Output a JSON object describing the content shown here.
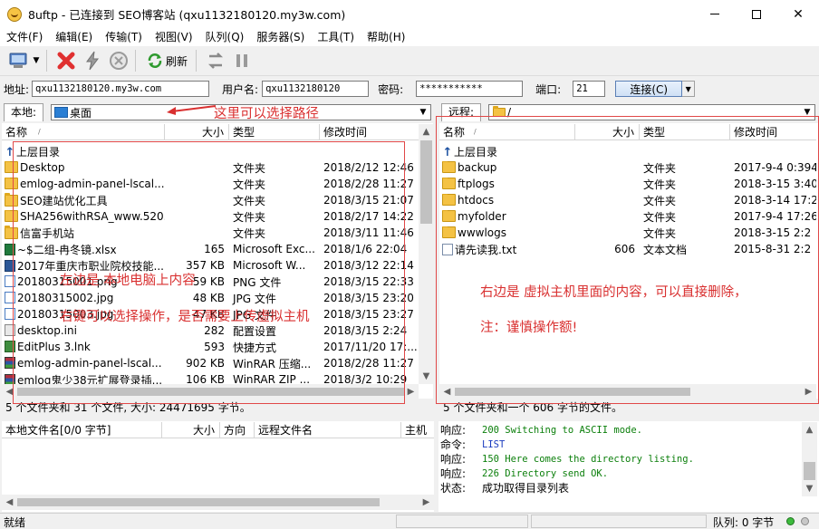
{
  "window": {
    "title": "8uftp - 已连接到 SEO博客站 (qxu1132180120.my3w.com)",
    "minimize": "—",
    "maximize": "☐",
    "close": "✕"
  },
  "menu": [
    "文件(F)",
    "编辑(E)",
    "传输(T)",
    "视图(V)",
    "队列(Q)",
    "服务器(S)",
    "工具(T)",
    "帮助(H)"
  ],
  "toolbar": {
    "refresh_label": "刷新"
  },
  "connection": {
    "address_label": "地址:",
    "address_value": "qxu1132180120.my3w.com",
    "user_label": "用户名:",
    "user_value": "qxu1132180120",
    "password_label": "密码:",
    "password_value": "***********",
    "port_label": "端口:",
    "port_value": "21",
    "connect_label": "连接(C)"
  },
  "local": {
    "tab_label": "本地:",
    "path": "桌面",
    "columns": {
      "name": "名称",
      "size": "大小",
      "type": "类型",
      "modified": "修改时间"
    },
    "parent_dir": "上层目录",
    "files": [
      {
        "icon": "folder",
        "name": "Desktop",
        "size": "",
        "type": "文件夹",
        "modified": "2018/2/12 12:46"
      },
      {
        "icon": "folder",
        "name": "emlog-admin-panel-lscal...",
        "size": "",
        "type": "文件夹",
        "modified": "2018/2/28 11:27"
      },
      {
        "icon": "folder",
        "name": "SEO建站优化工具",
        "size": "",
        "type": "文件夹",
        "modified": "2018/3/15 21:07"
      },
      {
        "icon": "folder",
        "name": "SHA256withRSA_www.520...",
        "size": "",
        "type": "文件夹",
        "modified": "2018/2/17 14:22"
      },
      {
        "icon": "folder",
        "name": "信富手机站",
        "size": "",
        "type": "文件夹",
        "modified": "2018/3/11 11:46"
      },
      {
        "icon": "xls",
        "name": "~$二组-冉冬镜.xlsx",
        "size": "165",
        "type": "Microsoft Exc...",
        "modified": "2018/1/6 22:04"
      },
      {
        "icon": "docx",
        "name": "2017年重庆市职业院校技能...",
        "size": "357 KB",
        "type": "Microsoft W...",
        "modified": "2018/3/12 22:14"
      },
      {
        "icon": "img",
        "name": "20180315001.png",
        "size": "59 KB",
        "type": "PNG 文件",
        "modified": "2018/3/15 22:33"
      },
      {
        "icon": "img",
        "name": "20180315002.jpg",
        "size": "48 KB",
        "type": "JPG 文件",
        "modified": "2018/3/15 23:20"
      },
      {
        "icon": "img",
        "name": "20180315003.jpg",
        "size": "47 KB",
        "type": "JPG 文件",
        "modified": "2018/3/15 23:27"
      },
      {
        "icon": "ini",
        "name": "desktop.ini",
        "size": "282",
        "type": "配置设置",
        "modified": "2018/3/15 2:24"
      },
      {
        "icon": "lnk",
        "name": "EditPlus 3.lnk",
        "size": "593",
        "type": "快捷方式",
        "modified": "2017/11/20 17:..."
      },
      {
        "icon": "rar",
        "name": "emlog-admin-panel-lscal...",
        "size": "902 KB",
        "type": "WinRAR 压缩...",
        "modified": "2018/2/28 11:27"
      },
      {
        "icon": "rar",
        "name": "emlog鬼少38元扩展登录插...",
        "size": "106 KB",
        "type": "WinRAR ZIP ...",
        "modified": "2018/3/2 10:29"
      }
    ],
    "status": "5 个文件夹和 31 个文件, 大小: 24471695 字节。"
  },
  "remote": {
    "tab_label": "远程:",
    "path": "/",
    "columns": {
      "name": "名称",
      "size": "大小",
      "type": "类型",
      "modified": "修改时间"
    },
    "parent_dir": "上层目录",
    "files": [
      {
        "icon": "folder",
        "name": "backup",
        "size": "",
        "type": "文件夹",
        "modified": "2017-9-4 0:394"
      },
      {
        "icon": "folder",
        "name": "ftplogs",
        "size": "",
        "type": "文件夹",
        "modified": "2018-3-15 3:40"
      },
      {
        "icon": "folder",
        "name": "htdocs",
        "size": "",
        "type": "文件夹",
        "modified": "2018-3-14 17:26"
      },
      {
        "icon": "folder",
        "name": "myfolder",
        "size": "",
        "type": "文件夹",
        "modified": "2017-9-4 17:26"
      },
      {
        "icon": "folder",
        "name": "wwwlogs",
        "size": "",
        "type": "文件夹",
        "modified": "2018-3-15 2:2"
      },
      {
        "icon": "doc",
        "name": "请先读我.txt",
        "size": "606",
        "type": "文本文档",
        "modified": "2015-8-31 2:2"
      }
    ],
    "status": "5 个文件夹和一个 606 字节的文件。"
  },
  "queue": {
    "columns": {
      "local_name": "本地文件名[0/0 字节]",
      "size": "大小",
      "direction": "方向",
      "remote_name": "远程文件名",
      "host": "主机"
    }
  },
  "log": [
    {
      "kind": "响应:",
      "msg": "200 Switching to ASCII mode.",
      "style": "resp"
    },
    {
      "kind": "命令:",
      "msg": "LIST",
      "style": "cmd"
    },
    {
      "kind": "响应:",
      "msg": "150 Here comes the directory listing.",
      "style": "resp"
    },
    {
      "kind": "响应:",
      "msg": "226 Directory send OK.",
      "style": "resp"
    },
    {
      "kind": "状态:",
      "msg": "成功取得目录列表",
      "style": "state"
    }
  ],
  "annotations": {
    "path_hint": "这里可以选择路径",
    "left_line1": "左边是 本地电脑上内容",
    "left_line2": "右键可以选择操作，是否需要上传虚拟主机",
    "right_line1": "右边是 虚拟主机里面的内容，可以直接删除，",
    "right_line2": "注：谨慎操作额!"
  },
  "bottom": {
    "ready": "就绪",
    "queue": "队列: 0 字节"
  },
  "colors": {
    "annotation": "#d93030",
    "log_response": "#0b7f0b",
    "log_command": "#1a3bbf"
  }
}
